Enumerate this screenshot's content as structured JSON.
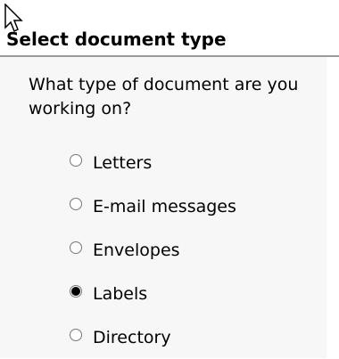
{
  "pane": {
    "title": "Select document type",
    "question": "What type of document are you working on?",
    "options": [
      {
        "label": "Letters",
        "checked": false
      },
      {
        "label": "E-mail messages",
        "checked": false
      },
      {
        "label": "Envelopes",
        "checked": false
      },
      {
        "label": "Labels",
        "checked": true
      },
      {
        "label": "Directory",
        "checked": false
      }
    ],
    "selected": "Labels"
  },
  "colors": {
    "background": "#ffffff",
    "body_background": "#f7f7f7",
    "separator": "#9a9a9a",
    "text": "#000000"
  },
  "icons": {
    "cursor": "mouse-pointer-icon"
  }
}
